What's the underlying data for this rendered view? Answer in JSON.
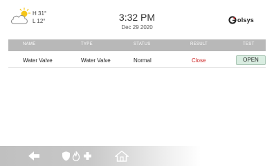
{
  "header": {
    "weather": {
      "icon": "partly-cloudy-icon",
      "high": "H 31°",
      "low": "L 12°"
    },
    "time": "3:32 PM",
    "date": "Dec 29 2020",
    "brand": "olsys"
  },
  "table": {
    "columns": [
      "NAME",
      "TYPE",
      "STATUS",
      "RESULT",
      "TEST"
    ],
    "rows": [
      {
        "name": "Water Valve",
        "type": "Water Valve",
        "status": "Normal",
        "result": "Close",
        "test_button": "OPEN"
      }
    ]
  },
  "navbar": {
    "items": [
      "back-arrow-icon",
      "shield-icon",
      "fire-icon",
      "medical-cross-icon",
      "home-icon"
    ]
  },
  "colors": {
    "header_bar": "#b8b8b8",
    "result_red": "#cc1f1f",
    "open_button": "#d9ede1",
    "sun": "#f5c518"
  }
}
